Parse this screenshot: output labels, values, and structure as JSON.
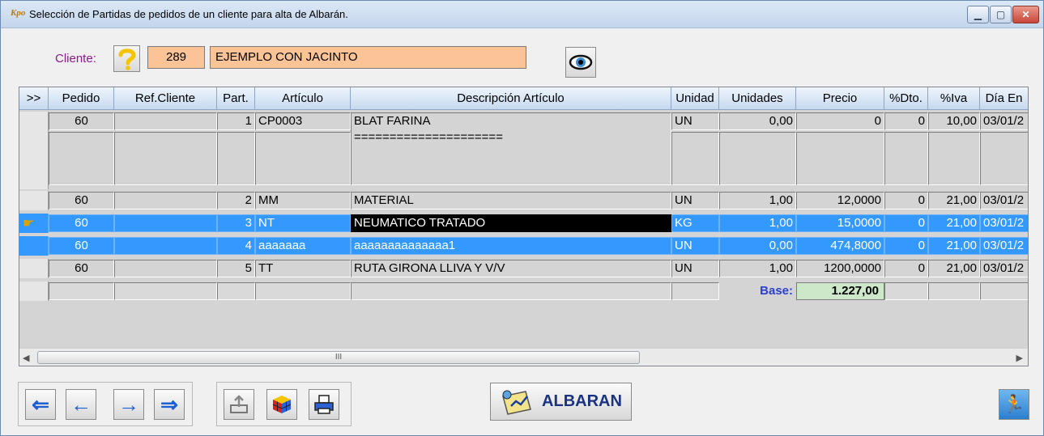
{
  "window": {
    "title": "Selección de Partidas de pedidos de un cliente para alta de Albarán.",
    "app_icon_text": "Kpo"
  },
  "client": {
    "label": "Cliente:",
    "code": "289",
    "name": "EJEMPLO CON JACINTO"
  },
  "grid": {
    "columns": [
      "Pedido",
      "Ref.Cliente",
      "Part.",
      "Artículo",
      "Descripción Artículo",
      "Unidad",
      "Unidades",
      "Precio",
      "%Dto.",
      "%Iva",
      "Día En"
    ],
    "row_indicator_header": ">>",
    "rows": [
      {
        "pedido": "60",
        "ref": "",
        "part": "1",
        "articulo": "CP0003",
        "descripcion": "BLAT FARINA",
        "descripcion2": "=====================",
        "unidad": "UN",
        "unidades": "0,00",
        "precio": "0",
        "dto": "0",
        "iva": "10,00",
        "dia": "03/01/2"
      },
      {
        "pedido": "60",
        "ref": "",
        "part": "2",
        "articulo": "MM",
        "descripcion": "MATERIAL",
        "unidad": "UN",
        "unidades": "1,00",
        "precio": "12,0000",
        "dto": "0",
        "iva": "21,00",
        "dia": "03/01/2"
      },
      {
        "pedido": "60",
        "ref": "",
        "part": "3",
        "articulo": "NT",
        "descripcion": "NEUMATICO TRATADO",
        "unidad": "KG",
        "unidades": "1,00",
        "precio": "15,0000",
        "dto": "0",
        "iva": "21,00",
        "dia": "03/01/2"
      },
      {
        "pedido": "60",
        "ref": "",
        "part": "4",
        "articulo": "aaaaaaa",
        "descripcion": "aaaaaaaaaaaaaa1",
        "unidad": "UN",
        "unidades": "0,00",
        "precio": "474,8000",
        "dto": "0",
        "iva": "21,00",
        "dia": "03/01/2"
      },
      {
        "pedido": "60",
        "ref": "",
        "part": "5",
        "articulo": "TT",
        "descripcion": "RUTA GIRONA LLIVA Y V/V",
        "unidad": "UN",
        "unidades": "1,00",
        "precio": "1200,0000",
        "dto": "0",
        "iva": "21,00",
        "dia": "03/01/2"
      }
    ],
    "base_label": "Base:",
    "base_value": "1.227,00",
    "scroll_thumb_glyph": "III"
  },
  "buttons": {
    "albaran_label": "ALBARAN"
  },
  "icons": {
    "help": "question-icon",
    "view": "eye-icon",
    "first": "arrow-first-icon",
    "prev": "arrow-prev-icon",
    "next": "arrow-next-icon",
    "last": "arrow-last-icon",
    "export": "export-icon",
    "cube": "rubik-cube-icon",
    "print": "printer-icon",
    "albaran": "document-icon",
    "exit": "runner-exit-icon"
  },
  "colors": {
    "client_label": "#8b1a8b",
    "client_field": "#fbc497",
    "selection": "#3399ff",
    "base_label": "#2a3fcf",
    "base_value_bg": "#cde8c8",
    "arrow": "#1e5fd1"
  }
}
